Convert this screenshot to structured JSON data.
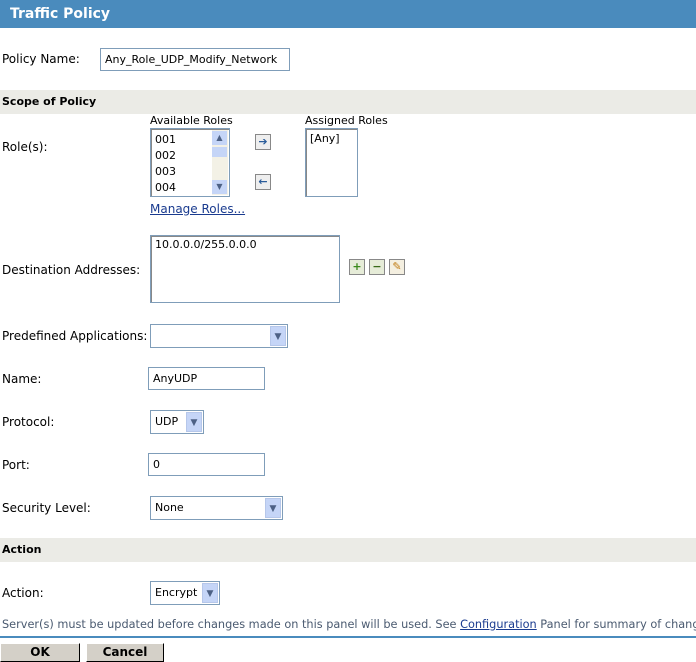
{
  "header": {
    "title": "Traffic Policy"
  },
  "policy_name": {
    "label": "Policy Name:",
    "value": "Any_Role_UDP_Modify_Network"
  },
  "scope": {
    "title": "Scope of Policy",
    "roles_label": "Role(s):",
    "available_label": "Available Roles",
    "available": [
      "001",
      "002",
      "003",
      "004"
    ],
    "assigned_label": "Assigned Roles",
    "assigned": [
      "[Any]"
    ],
    "manage_roles": "Manage Roles...",
    "dest_label": "Destination Addresses:",
    "destinations": [
      "10.0.0.0/255.0.0.0"
    ],
    "predefined_label": "Predefined Applications:",
    "predefined_value": "",
    "name_label": "Name:",
    "name_value": "AnyUDP",
    "protocol_label": "Protocol:",
    "protocol_value": "UDP",
    "port_label": "Port:",
    "port_value": "0",
    "security_label": "Security Level:",
    "security_value": "None"
  },
  "action": {
    "title": "Action",
    "label": "Action:",
    "value": "Encrypt"
  },
  "note": {
    "before": "Server(s) must be updated before changes made on this panel will be used. See ",
    "link": "Configuration",
    "after": " Panel for summary of changes."
  },
  "buttons": {
    "ok": "OK",
    "cancel": "Cancel"
  }
}
